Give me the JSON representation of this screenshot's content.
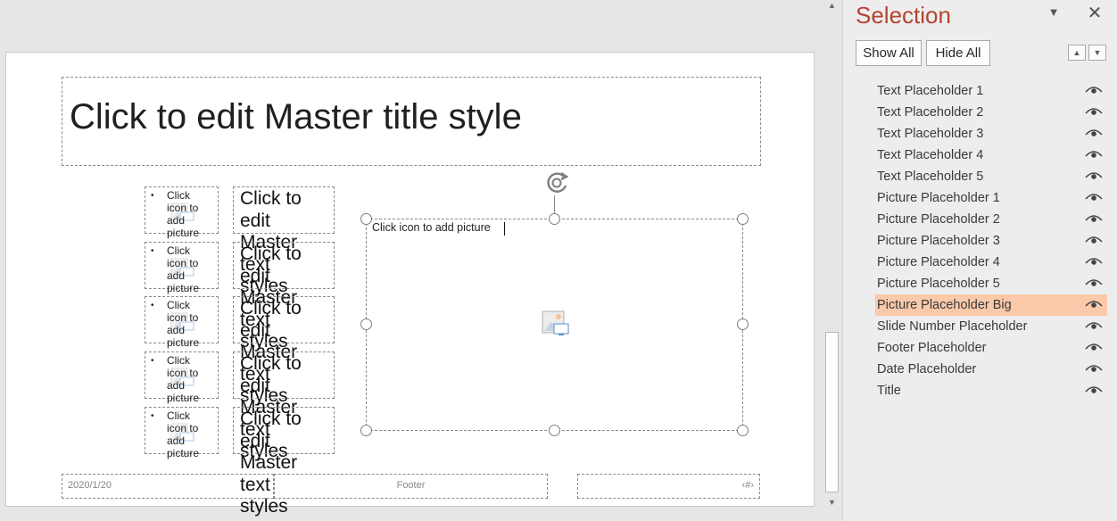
{
  "slide": {
    "title": "Click to edit Master title style",
    "picture_items": [
      {
        "bullet": "•",
        "text": "Click icon to add picture"
      },
      {
        "bullet": "•",
        "text": "Click icon to add picture"
      },
      {
        "bullet": "•",
        "text": "Click icon to add picture"
      },
      {
        "bullet": "•",
        "text": "Click icon to add picture"
      },
      {
        "bullet": "•",
        "text": "Click icon to add picture"
      }
    ],
    "text_items": [
      "Click to edit Master text styles",
      "Click to edit Master text styles",
      "Click to edit Master text styles",
      "Click to edit Master text styles",
      "Click to edit Master text styles"
    ],
    "big_picture_label": "Click icon to add picture",
    "date": "2020/1/20",
    "footer": "Footer",
    "slide_number": "‹#›"
  },
  "pane": {
    "title": "Selection",
    "show_all": "Show All",
    "hide_all": "Hide All",
    "items": [
      {
        "label": "Text Placeholder 1",
        "selected": false
      },
      {
        "label": "Text Placeholder 2",
        "selected": false
      },
      {
        "label": "Text Placeholder 3",
        "selected": false
      },
      {
        "label": "Text Placeholder 4",
        "selected": false
      },
      {
        "label": "Text Placeholder 5",
        "selected": false
      },
      {
        "label": "Picture Placeholder 1",
        "selected": false
      },
      {
        "label": "Picture Placeholder 2",
        "selected": false
      },
      {
        "label": "Picture Placeholder 3",
        "selected": false
      },
      {
        "label": "Picture Placeholder 4",
        "selected": false
      },
      {
        "label": "Picture Placeholder 5",
        "selected": false
      },
      {
        "label": "Picture Placeholder Big",
        "selected": true
      },
      {
        "label": "Slide Number Placeholder",
        "selected": false
      },
      {
        "label": "Footer Placeholder",
        "selected": false
      },
      {
        "label": "Date Placeholder",
        "selected": false
      },
      {
        "label": "Title",
        "selected": false
      }
    ]
  },
  "colors": {
    "accent": "#b5432f",
    "selection_highlight": "#f9c9aa"
  },
  "icons": {
    "rotate": "rotate-handle-icon",
    "picture": "picture-icon",
    "eye": "eye-icon",
    "close": "close-icon",
    "menu": "chevron-down-icon",
    "up": "move-up-icon",
    "down": "move-down-icon"
  }
}
